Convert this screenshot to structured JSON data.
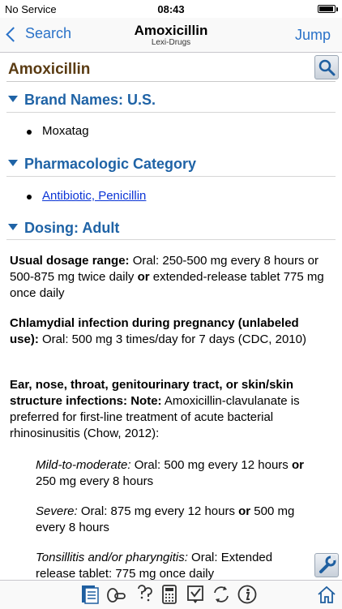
{
  "status_bar": {
    "carrier": "No Service",
    "time": "08:43",
    "battery_level": 0.95
  },
  "nav": {
    "back_label": "Search",
    "title": "Amoxicillin",
    "subtitle": "Lexi-Drugs",
    "jump_label": "Jump"
  },
  "drug": {
    "title": "Amoxicillin"
  },
  "sections": {
    "brand_names": {
      "heading": "Brand Names: U.S.",
      "items": [
        "Moxatag"
      ]
    },
    "pharm_category": {
      "heading": "Pharmacologic Category",
      "links": [
        "Antibiotic, Penicillin"
      ]
    },
    "dosing_adult": {
      "heading": "Dosing: Adult",
      "usual": {
        "label": "Usual dosage range:",
        "text1": " Oral: 250-500 mg every 8 hours or 500-875 mg twice daily ",
        "bold_or": "or",
        "text2": " extended-release tablet 775 mg once daily"
      },
      "chlamydial": {
        "label": "Chlamydial infection during pregnancy (unlabeled use):",
        "text": " Oral: 500 mg 3 times/day for 7 days (CDC, 2010)"
      },
      "ent": {
        "label": "Ear, nose, throat, genitourinary tract, or skin/skin structure infections:",
        "note_label": " Note:",
        "text": " Amoxicillin-clavulanate is preferred for first-line treatment of acute bacterial rhinosinusitis (Chow, 2012):"
      },
      "mild": {
        "label": "Mild-to-moderate:",
        "text1": " Oral: 500 mg every 12 hours ",
        "bold_or": "or",
        "text2": " 250 mg every 8 hours"
      },
      "severe": {
        "label": "Severe:",
        "text1": " Oral: 875 mg every 12 hours ",
        "bold_or": "or",
        "text2": " 500 mg every 8 hours"
      },
      "tonsillitis": {
        "label": "Tonsillitis and/or pharyngitis:",
        "text": " Oral: Extended release tablet: 775 mg once daily"
      }
    }
  },
  "tab_bar": {
    "icons": [
      "monograph-icon",
      "interactions-icon",
      "identification-icon",
      "calculator-icon",
      "checklist-icon",
      "refresh-icon",
      "info-icon",
      "home-icon"
    ]
  }
}
